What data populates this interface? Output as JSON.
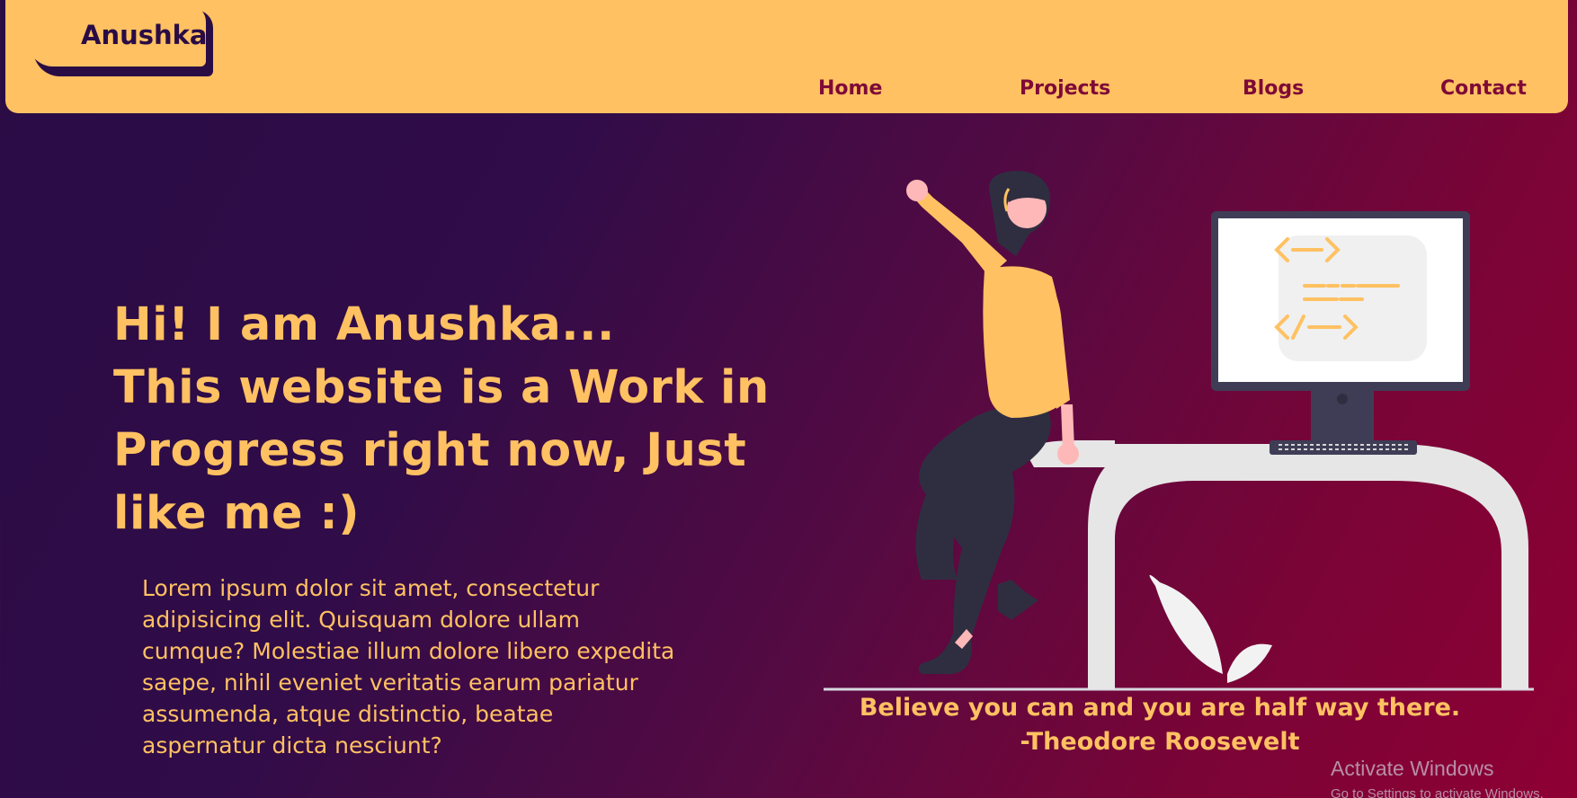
{
  "brand": {
    "name": "Anushka"
  },
  "nav": {
    "items": [
      {
        "label": "Home"
      },
      {
        "label": "Projects"
      },
      {
        "label": "Blogs"
      },
      {
        "label": "Contact"
      }
    ]
  },
  "hero": {
    "title_lines": [
      "Hi! I am Anushka...",
      "This website is a Work in",
      "Progress right now, Just",
      "like me :)"
    ],
    "paragraph_lines": [
      "Lorem ipsum dolor sit amet, consectetur",
      "adipisicing elit. Quisquam dolore ullam",
      "cumque? Molestiae illum dolore libero expedita",
      "saepe, nihil eveniet veritatis earum pariatur",
      "assumenda, atque distinctio, beatae",
      "aspernatur dicta nesciunt?"
    ]
  },
  "illustration": {
    "icon": "developer-at-desk-illustration",
    "monitor_icon": "code-brackets-icon"
  },
  "quote": {
    "line1": "Believe you can and you are half way there.",
    "line2": "-Theodore Roosevelt"
  },
  "watermark": {
    "line1": "Activate Windows",
    "line2": "Go to Settings to activate Windows."
  },
  "colors": {
    "accent": "#ffc162",
    "nav_text": "#7e0a37",
    "bg_start": "#2a0c45",
    "bg_end": "#8e0034"
  }
}
